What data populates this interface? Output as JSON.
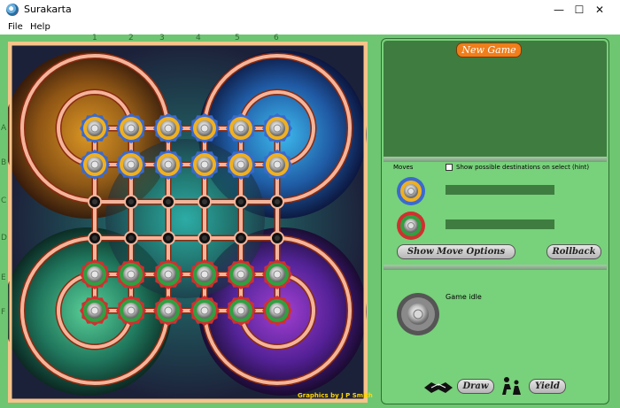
{
  "window": {
    "title": "Surakarta",
    "minimize_glyph": "—",
    "maximize_glyph": "☐",
    "close_glyph": "✕"
  },
  "menu": {
    "items": [
      "File",
      "Help"
    ]
  },
  "board": {
    "column_labels": [
      "1",
      "2",
      "3",
      "4",
      "5",
      "6"
    ],
    "row_labels": [
      "A",
      "B",
      "C",
      "D",
      "E",
      "F"
    ],
    "credit": "Graphics by J P Smith",
    "pieces": [
      {
        "row": "A",
        "col": 1,
        "player": "top"
      },
      {
        "row": "A",
        "col": 2,
        "player": "top"
      },
      {
        "row": "A",
        "col": 3,
        "player": "top"
      },
      {
        "row": "A",
        "col": 4,
        "player": "top"
      },
      {
        "row": "A",
        "col": 5,
        "player": "top"
      },
      {
        "row": "A",
        "col": 6,
        "player": "top"
      },
      {
        "row": "B",
        "col": 1,
        "player": "top"
      },
      {
        "row": "B",
        "col": 2,
        "player": "top"
      },
      {
        "row": "B",
        "col": 3,
        "player": "top"
      },
      {
        "row": "B",
        "col": 4,
        "player": "top"
      },
      {
        "row": "B",
        "col": 5,
        "player": "top"
      },
      {
        "row": "B",
        "col": 6,
        "player": "top"
      },
      {
        "row": "E",
        "col": 1,
        "player": "bottom"
      },
      {
        "row": "E",
        "col": 2,
        "player": "bottom"
      },
      {
        "row": "E",
        "col": 3,
        "player": "bottom"
      },
      {
        "row": "E",
        "col": 4,
        "player": "bottom"
      },
      {
        "row": "E",
        "col": 5,
        "player": "bottom"
      },
      {
        "row": "E",
        "col": 6,
        "player": "bottom"
      },
      {
        "row": "F",
        "col": 1,
        "player": "bottom"
      },
      {
        "row": "F",
        "col": 2,
        "player": "bottom"
      },
      {
        "row": "F",
        "col": 3,
        "player": "bottom"
      },
      {
        "row": "F",
        "col": 4,
        "player": "bottom"
      },
      {
        "row": "F",
        "col": 5,
        "player": "bottom"
      },
      {
        "row": "F",
        "col": 6,
        "player": "bottom"
      }
    ],
    "colors": {
      "track": "#f4b49a",
      "track_edge": "#8a2a10",
      "frame": "#f5c48a",
      "top_piece_ring": "#f0b020",
      "bottom_piece_ring": "#30a040"
    }
  },
  "panel": {
    "new_game_label": "New Game",
    "moves_label": "Moves",
    "hint_label": "Show possible destinations on select (hint)",
    "hint_checked": false,
    "show_move_options_label": "Show Move Options",
    "rollback_label": "Rollback",
    "status_text": "Game idle",
    "draw_label": "Draw",
    "yield_label": "Yield",
    "icons": [
      "handshake-icon",
      "surrender-icon"
    ]
  }
}
